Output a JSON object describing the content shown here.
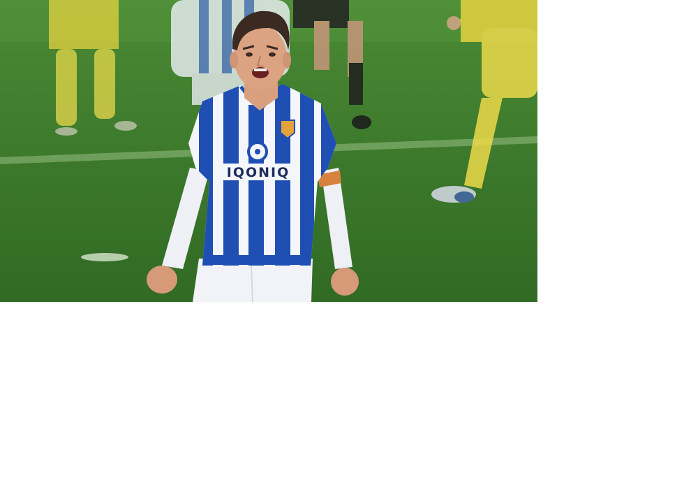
{
  "photo": {
    "sponsor_text": "IQONIQ",
    "colors": {
      "pitch": "#3f7a2e",
      "pitch_light": "#5c9640",
      "jersey_blue": "#1f4fb3",
      "jersey_white": "#f4f6fb",
      "opponent_yellow": "#e7d63a",
      "skin": "#d9a07f",
      "hair": "#3b2a22"
    }
  }
}
